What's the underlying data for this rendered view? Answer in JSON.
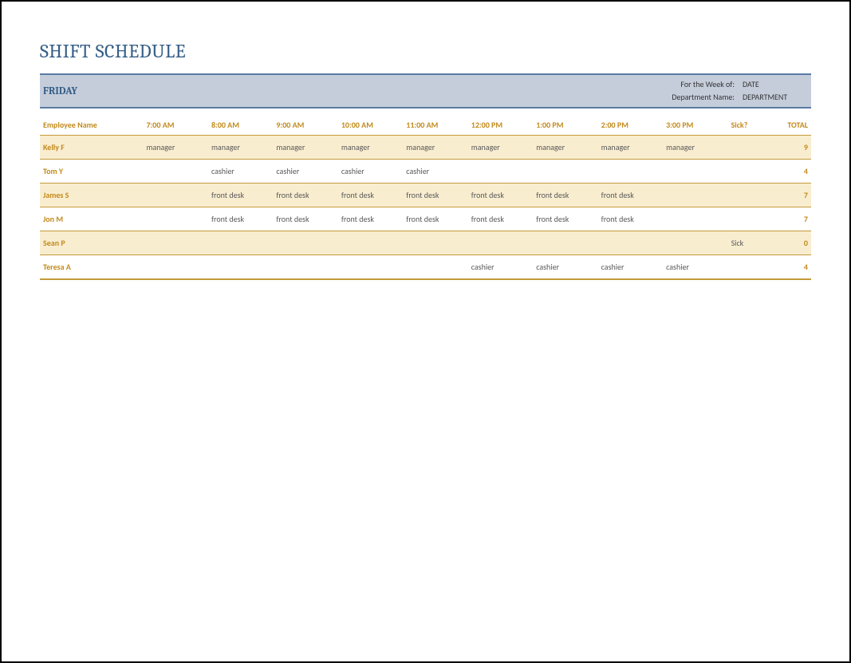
{
  "title": "SHIFT SCHEDULE",
  "day": "FRIDAY",
  "meta": {
    "week_label": "For the Week of:",
    "week_value": "DATE",
    "dept_label": "Department Name:",
    "dept_value": "DEPARTMENT"
  },
  "columns": {
    "name": "Employee Name",
    "hours": [
      "7:00 AM",
      "8:00 AM",
      "9:00 AM",
      "10:00 AM",
      "11:00 AM",
      "12:00 PM",
      "1:00 PM",
      "2:00 PM",
      "3:00 PM"
    ],
    "sick": "Sick?",
    "total": "TOTAL"
  },
  "rows": [
    {
      "name": "Kelly F",
      "cells": [
        "manager",
        "manager",
        "manager",
        "manager",
        "manager",
        "manager",
        "manager",
        "manager",
        "manager"
      ],
      "sick": "",
      "total": "9"
    },
    {
      "name": "Tom Y",
      "cells": [
        "",
        "cashier",
        "cashier",
        "cashier",
        "cashier",
        "",
        "",
        "",
        ""
      ],
      "sick": "",
      "total": "4"
    },
    {
      "name": "James S",
      "cells": [
        "",
        "front desk",
        "front desk",
        "front desk",
        "front desk",
        "front desk",
        "front desk",
        "front desk",
        ""
      ],
      "sick": "",
      "total": "7"
    },
    {
      "name": "Jon M",
      "cells": [
        "",
        "front desk",
        "front desk",
        "front desk",
        "front desk",
        "front desk",
        "front desk",
        "front desk",
        ""
      ],
      "sick": "",
      "total": "7"
    },
    {
      "name": "Sean P",
      "cells": [
        "",
        "",
        "",
        "",
        "",
        "",
        "",
        "",
        ""
      ],
      "sick": "Sick",
      "total": "0"
    },
    {
      "name": "Teresa A",
      "cells": [
        "",
        "",
        "",
        "",
        "",
        "cashier",
        "cashier",
        "cashier",
        "cashier"
      ],
      "sick": "",
      "total": "4"
    }
  ]
}
